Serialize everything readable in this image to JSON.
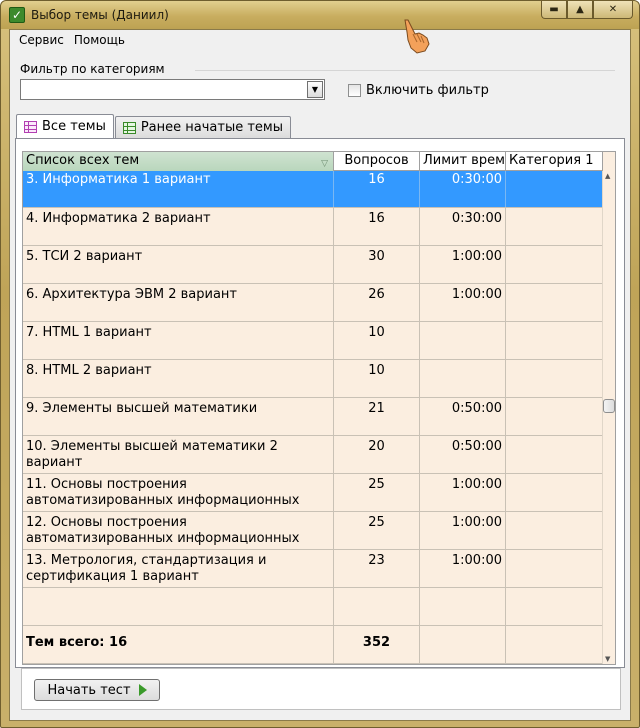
{
  "window": {
    "title": "Выбор темы (Даниил)"
  },
  "menu": [
    "Сервис",
    "Помощь"
  ],
  "filter": {
    "legend": "Фильтр по категориям",
    "combo_value": "",
    "enable_label": "Включить фильтр"
  },
  "tabs": [
    {
      "label": "Все темы",
      "icon": "table-icon-purple"
    },
    {
      "label": "Ранее начатые темы",
      "icon": "table-icon-green"
    }
  ],
  "grid": {
    "columns": [
      "Список всех тем",
      "Вопросов",
      "Лимит времени",
      "Категория 1"
    ],
    "rows": [
      {
        "name": "3. Информатика 1 вариант",
        "questions": "16",
        "limit": "0:30:00",
        "category": ""
      },
      {
        "name": "4. Информатика 2 вариант",
        "questions": "16",
        "limit": "0:30:00",
        "category": ""
      },
      {
        "name": "5. ТСИ 2 вариант",
        "questions": "30",
        "limit": "1:00:00",
        "category": ""
      },
      {
        "name": "6. Архитектура ЭВМ 2 вариант",
        "questions": "26",
        "limit": "1:00:00",
        "category": ""
      },
      {
        "name": "7. HTML 1 вариант",
        "questions": "10",
        "limit": "",
        "category": ""
      },
      {
        "name": "8. HTML 2 вариант",
        "questions": "10",
        "limit": "",
        "category": ""
      },
      {
        "name": "9. Элементы высшей математики",
        "questions": "21",
        "limit": "0:50:00",
        "category": ""
      },
      {
        "name": "10. Элементы высшей математики 2 вариант",
        "questions": "20",
        "limit": "0:50:00",
        "category": ""
      },
      {
        "name": "11. Основы построения автоматизированных информационных",
        "questions": "25",
        "limit": "1:00:00",
        "category": ""
      },
      {
        "name": "12. Основы построения автоматизированных информационных",
        "questions": "25",
        "limit": "1:00:00",
        "category": ""
      },
      {
        "name": "13. Метрология, стандартизация и сертификация 1 вариант",
        "questions": "23",
        "limit": "1:00:00",
        "category": ""
      },
      {
        "name": "",
        "questions": "",
        "limit": "",
        "category": ""
      }
    ],
    "total": {
      "label": "Тем всего: 16",
      "questions": "352"
    }
  },
  "buttons": {
    "start_test": "Начать тест"
  },
  "colors": {
    "selection": "#3399ff",
    "row_bg": "#fbeee0",
    "sorted_header": "#bfd9c2"
  }
}
